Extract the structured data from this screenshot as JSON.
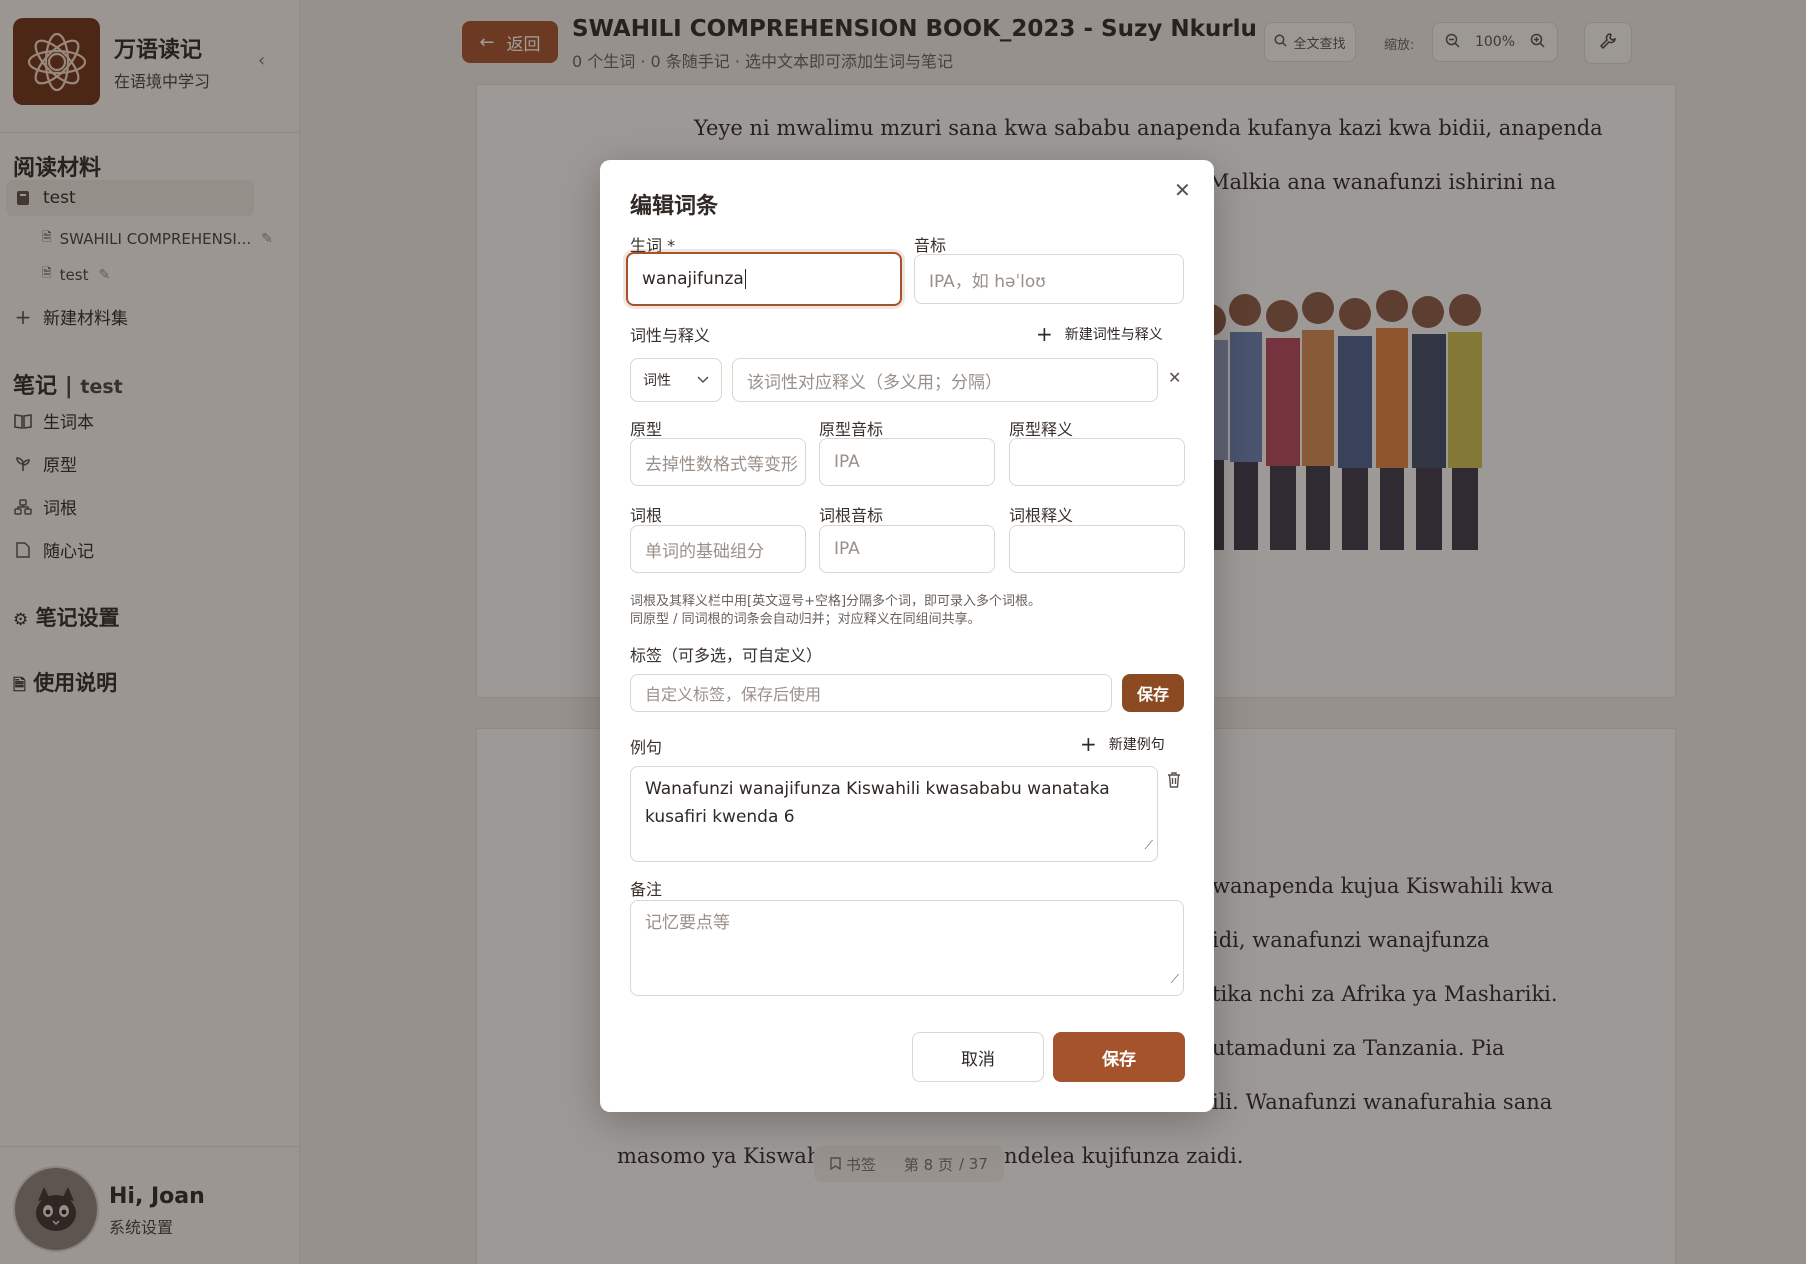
{
  "app": {
    "title": "万语读记",
    "subtitle": "在语境中学习"
  },
  "sidebar": {
    "materials_heading": "阅读材料",
    "collection": "test",
    "docs": [
      "SWAHILI COMPREHENSI...",
      "test"
    ],
    "new_collection": "新建材料集",
    "notes_heading": "笔记",
    "notes_context": "test",
    "notes_items": [
      "生词本",
      "原型",
      "词根",
      "随心记"
    ],
    "settings": "笔记设置",
    "help": "使用说明"
  },
  "user": {
    "greeting": "Hi, Joan",
    "settings_link": "系统设置"
  },
  "header": {
    "back_label": "返回",
    "doc_title": "SWAHILI COMPREHENSION BOOK_2023 - Suzy Nkurlu",
    "doc_stats": "0 个生词 · 0 条随手记 · 选中文本即可添加生词与笔记",
    "search_label": "全文查找",
    "zoom_label": "缩放:",
    "zoom_value": "100%"
  },
  "reader": {
    "page1_lines": [
      "Yeye ni mwalimu mzuri sana kwa sababu anapenda kufanya kazi kwa bidii, anapenda",
      "Malkia ana wanafunzi ishirini na"
    ],
    "page2_lines": [
      "wanapenda kujua Kiswahili kwa",
      "idi, wanafunzi wanajfunza",
      "tika nchi za Afrika ya Mashariki.",
      "utamaduni za Tanzania. Pia",
      "ili. Wanafunzi wanafurahia sana",
      "masomo ya Kiswahi",
      "ndelea kujifunza zaidi."
    ],
    "bookmark_label": "书签",
    "page_indicator": "第 8 页",
    "page_total": "/ 37"
  },
  "modal": {
    "title": "编辑词条",
    "word_label": "生词 *",
    "word_value": "wanajifunza",
    "phonetic_label": "音标",
    "phonetic_placeholder": "IPA，如 həˈloʊ",
    "pos_section_label": "词性与释义",
    "add_pos_label": "新建词性与释义",
    "pos_select": "词性",
    "meaning_placeholder": "该词性对应释义（多义用；分隔）",
    "lemma_label": "原型",
    "lemma_placeholder": "去掉性数格式等变形",
    "lemma_phonetic_label": "原型音标",
    "lemma_phonetic_placeholder": "IPA",
    "lemma_meaning_label": "原型释义",
    "root_label": "词根",
    "root_placeholder": "单词的基础组分",
    "root_phonetic_label": "词根音标",
    "root_phonetic_placeholder": "IPA",
    "root_meaning_label": "词根释义",
    "hint_line1": "词根及其释义栏中用[英文逗号+空格]分隔多个词，即可录入多个词根。",
    "hint_line2": "同原型 / 同词根的词条会自动归并；对应释义在同组间共享。",
    "tags_label": "标签（可多选，可自定义）",
    "tags_placeholder": "自定义标签，保存后使用",
    "tags_save": "保存",
    "example_label": "例句",
    "add_example_label": "新建例句",
    "example_value": "Wanafunzi wanajifunza Kiswahili kwasababu wanataka kusafiri kwenda 6",
    "notes_label": "备注",
    "notes_placeholder": "记忆要点等",
    "cancel_label": "取消",
    "save_label": "保存"
  },
  "colors": {
    "accent": "#a4532c",
    "accent_dark": "#8b4a22",
    "logo_bg": "#6e3217"
  }
}
